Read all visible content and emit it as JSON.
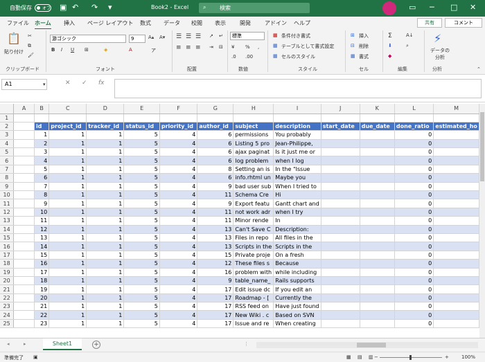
{
  "titlebar": {
    "autosave_label": "自動保存",
    "autosave_state": "オフ",
    "doc_title": "Book2 - Excel",
    "search_placeholder": "検索"
  },
  "tabs": [
    "ファイル",
    "ホーム",
    "挿入",
    "ページ レイアウト",
    "数式",
    "データ",
    "校閲",
    "表示",
    "開発",
    "アドイン",
    "ヘルプ"
  ],
  "share_label": "共有",
  "comment_label": "コメント",
  "ribbon": {
    "paste_label": "貼り付け",
    "clipboard_label": "クリップボード",
    "font_name": "游ゴシック",
    "font_size": "9",
    "font_label": "フォント",
    "align_label": "配置",
    "number_format": "標準",
    "number_label": "数値",
    "cond_format": "条件付き書式",
    "table_format": "テーブルとして書式設定",
    "cell_styles": "セルのスタイル",
    "style_label": "スタイル",
    "insert": "挿入",
    "delete": "削除",
    "format": "書式",
    "cells_label": "セル",
    "edit_label": "編集",
    "analyze_button": "データの分析",
    "analyze_label": "分析"
  },
  "namebox": "A1",
  "columns": [
    "A",
    "B",
    "C",
    "D",
    "E",
    "F",
    "G",
    "H",
    "I",
    "J",
    "K",
    "L",
    "M"
  ],
  "header_row": [
    "id",
    "project_id",
    "tracker_id",
    "status_id",
    "priority_id",
    "author_id",
    "subject",
    "description",
    "start_date",
    "due_date",
    "done_ratio",
    "estimated_ho"
  ],
  "rows": [
    [
      "1",
      "1",
      "1",
      "5",
      "4",
      "6",
      "permissions",
      "You probably",
      "",
      "",
      "0",
      ""
    ],
    [
      "2",
      "1",
      "1",
      "5",
      "4",
      "6",
      "Listing 5 pro",
      "Jean-Philippe,",
      "",
      "",
      "0",
      ""
    ],
    [
      "3",
      "1",
      "1",
      "5",
      "4",
      "6",
      "ajax paginat",
      "Is it just me or",
      "",
      "",
      "0",
      ""
    ],
    [
      "4",
      "1",
      "1",
      "5",
      "4",
      "6",
      "log problem",
      "when I log",
      "",
      "",
      "0",
      ""
    ],
    [
      "5",
      "1",
      "1",
      "5",
      "4",
      "8",
      "Setting an is",
      "In the \"Issue",
      "",
      "",
      "0",
      ""
    ],
    [
      "6",
      "1",
      "1",
      "5",
      "4",
      "6",
      "info.rhtml un",
      "Maybe you",
      "",
      "",
      "0",
      ""
    ],
    [
      "7",
      "1",
      "1",
      "5",
      "4",
      "9",
      "bad user sub",
      "When I tried to",
      "",
      "",
      "0",
      ""
    ],
    [
      "8",
      "1",
      "1",
      "5",
      "4",
      "11",
      "Schema Cre",
      "Hi",
      "",
      "",
      "0",
      ""
    ],
    [
      "9",
      "1",
      "1",
      "5",
      "4",
      "9",
      "Export featu",
      "Gantt chart and",
      "",
      "",
      "0",
      ""
    ],
    [
      "10",
      "1",
      "1",
      "5",
      "4",
      "11",
      "not work adr",
      "when I try",
      "",
      "",
      "0",
      ""
    ],
    [
      "11",
      "1",
      "1",
      "5",
      "4",
      "11",
      "Minor rende",
      "In",
      "",
      "",
      "0",
      ""
    ],
    [
      "12",
      "1",
      "1",
      "5",
      "4",
      "13",
      "Can't Save C",
      "Description:",
      "",
      "",
      "0",
      ""
    ],
    [
      "13",
      "1",
      "1",
      "5",
      "4",
      "13",
      "Files in repo",
      "All files in the",
      "",
      "",
      "0",
      ""
    ],
    [
      "14",
      "1",
      "1",
      "5",
      "4",
      "13",
      "Scripts in the",
      "Scripts in the",
      "",
      "",
      "0",
      ""
    ],
    [
      "15",
      "1",
      "1",
      "5",
      "4",
      "15",
      "Private proje",
      "On a fresh",
      "",
      "",
      "0",
      ""
    ],
    [
      "16",
      "1",
      "1",
      "5",
      "4",
      "12",
      "These files s",
      "Because",
      "",
      "",
      "0",
      ""
    ],
    [
      "17",
      "1",
      "1",
      "5",
      "4",
      "16",
      "problem with",
      "while including",
      "",
      "",
      "0",
      ""
    ],
    [
      "18",
      "1",
      "1",
      "5",
      "4",
      "9",
      "table_name_",
      "Rails supports",
      "",
      "",
      "0",
      ""
    ],
    [
      "19",
      "1",
      "1",
      "5",
      "4",
      "17",
      "Edit issue dc",
      "If you edit an",
      "",
      "",
      "0",
      ""
    ],
    [
      "20",
      "1",
      "1",
      "5",
      "4",
      "17",
      "Roadmap - [",
      "Currently the",
      "",
      "",
      "0",
      ""
    ],
    [
      "21",
      "1",
      "1",
      "5",
      "4",
      "17",
      "RSS feed on",
      "Have just found",
      "",
      "",
      "0",
      ""
    ],
    [
      "22",
      "1",
      "1",
      "5",
      "4",
      "17",
      "New Wiki . c",
      "Based on SVN",
      "",
      "",
      "0",
      ""
    ],
    [
      "23",
      "1",
      "1",
      "5",
      "4",
      "17",
      "Issue and re",
      "When creating",
      "",
      "",
      "0",
      ""
    ]
  ],
  "sheet_tab": "Sheet1",
  "status": {
    "ready": "準備完了",
    "zoom": "100%"
  },
  "colors": {
    "excel_green": "#217346",
    "header_blue": "#4472c4",
    "band_blue": "#d9e1f2"
  }
}
